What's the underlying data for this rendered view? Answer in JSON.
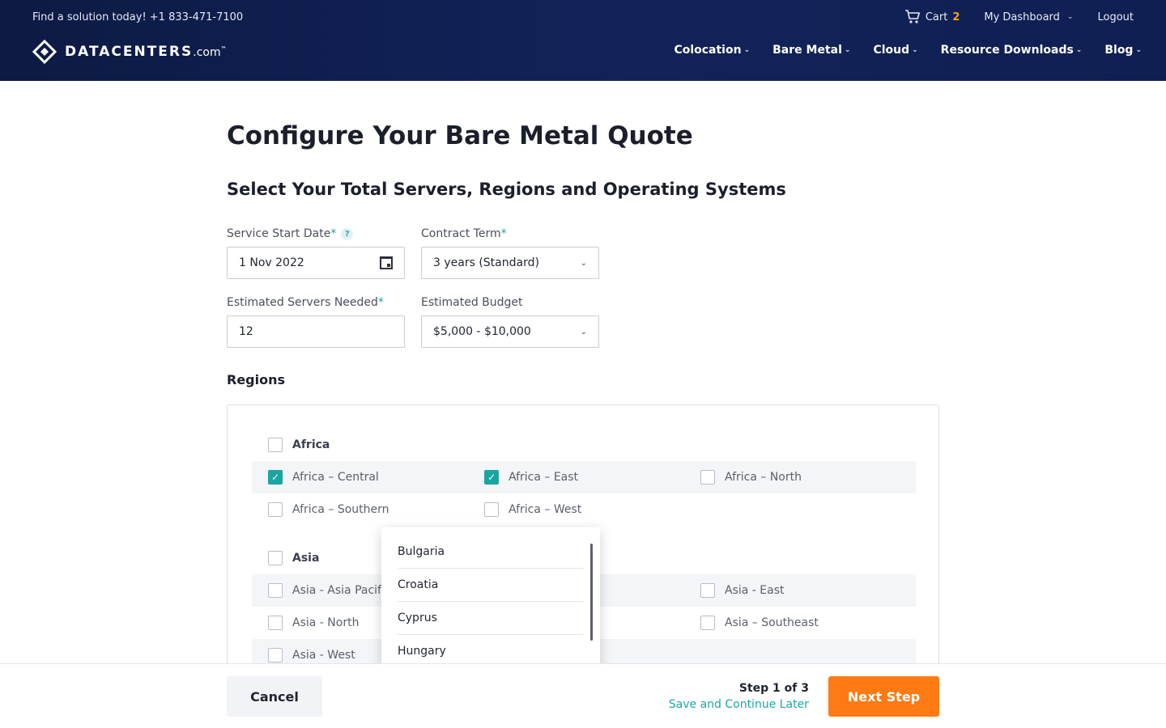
{
  "header": {
    "phone_text": "Find a solution today! +1 833-471-7100",
    "cart_label": "Cart",
    "cart_count": "2",
    "dashboard_label": "My Dashboard",
    "logout_label": "Logout",
    "logo_text_bold": "DATACENTERS",
    "logo_text_light": ".com",
    "logo_tm": "™",
    "nav": [
      "Colocation",
      "Bare Metal",
      "Cloud",
      "Resource Downloads",
      "Blog"
    ]
  },
  "page": {
    "title": "Configure Your Bare Metal Quote",
    "section_title": "Select Your Total Servers, Regions and Operating Systems"
  },
  "form": {
    "start_date_label": "Service Start Date",
    "start_date_value": "1 Nov 2022",
    "contract_label": "Contract Term",
    "contract_value": "3 years (Standard)",
    "servers_label": "Estimated Servers Needed",
    "servers_value": "12",
    "budget_label": "Estimated Budget",
    "budget_value": "$5,000 - $10,000",
    "required_mark": "*",
    "help_mark": "?"
  },
  "regions": {
    "label": "Regions",
    "africa": {
      "name": "Africa",
      "options": [
        "Africa – Central",
        "Africa – East",
        "Africa – North",
        "Africa – Southern",
        "Africa – West"
      ],
      "checked": [
        true,
        true,
        false,
        false,
        false
      ]
    },
    "asia": {
      "name": "Asia",
      "options": [
        "Asia - Asia Pacific",
        "Asia - East",
        "Asia - North",
        "Asia – Southeast",
        "Asia - West"
      ]
    }
  },
  "popup": {
    "items": [
      "Bulgaria",
      "Croatia",
      "Cyprus",
      "Hungary"
    ]
  },
  "footer": {
    "cancel_label": "Cancel",
    "step_text": "Step 1 of 3",
    "save_later": "Save and Continue Later",
    "next_label": "Next Step"
  },
  "colors": {
    "accent_teal": "#1aa6a0",
    "cta_orange": "#ff7a12",
    "header_navy": "#0d1a44"
  }
}
